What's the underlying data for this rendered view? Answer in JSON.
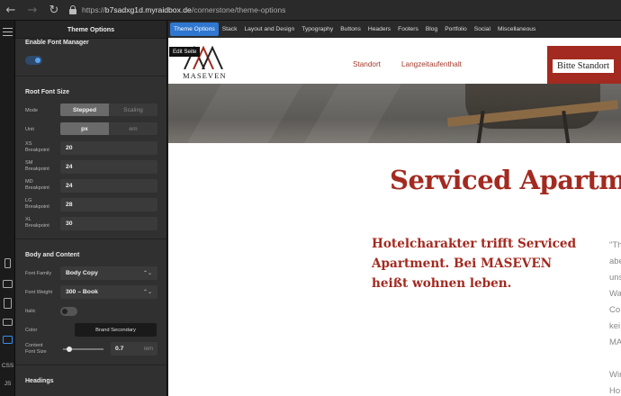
{
  "browser": {
    "url_scheme": "https://",
    "url_host": "b7sadxg1d.myraidbox.de",
    "url_path": "/cornerstone/theme-options"
  },
  "rail": {
    "css_label": "CSS",
    "js_label": "JS"
  },
  "panel": {
    "title": "Theme Options",
    "enable_font_manager": {
      "label": "Enable Font Manager",
      "enabled": true
    },
    "root_font_size": {
      "title": "Root Font Size",
      "mode": {
        "label": "Mode",
        "options": [
          "Stepped",
          "Scaling"
        ],
        "selected": "Stepped"
      },
      "unit": {
        "label": "Unit",
        "options": [
          "px",
          "em"
        ],
        "selected": "px"
      },
      "breakpoints": [
        {
          "label": "XS Breakpoint",
          "line1": "XS",
          "line2": "Breakpoint",
          "value": "20"
        },
        {
          "label": "SM Breakpoint",
          "line1": "SM",
          "line2": "Breakpoint",
          "value": "24"
        },
        {
          "label": "MD Breakpoint",
          "line1": "MD",
          "line2": "Breakpoint",
          "value": "24"
        },
        {
          "label": "LG Breakpoint",
          "line1": "LG",
          "line2": "Breakpoint",
          "value": "28"
        },
        {
          "label": "XL Breakpoint",
          "line1": "XL",
          "line2": "Breakpoint",
          "value": "30"
        }
      ]
    },
    "body_and_content": {
      "title": "Body and Content",
      "font_family": {
        "label": "Font Family",
        "value": "Body Copy"
      },
      "font_weight": {
        "label": "Font Weight",
        "value": "300 – Book"
      },
      "italic": {
        "label": "Italic",
        "enabled": false
      },
      "color": {
        "label": "Color",
        "value": "Brand Secondary"
      },
      "content_font_size": {
        "label_line1": "Content",
        "label_line2": "Font Size",
        "value": "0.7",
        "unit": "rem",
        "slider_fraction": 0.15
      }
    },
    "headings": {
      "title": "Headings"
    }
  },
  "tabs": [
    "Theme Options",
    "Stack",
    "Layout and Design",
    "Typography",
    "Buttons",
    "Headers",
    "Footers",
    "Blog",
    "Portfolio",
    "Social",
    "Miscellaneous"
  ],
  "selected_tab": "Theme Options",
  "preview": {
    "edit_label": "Edit Seite",
    "logo_text": "MASEVEN",
    "nav": [
      "Standort",
      "Langzeitaufenthalt"
    ],
    "cta": "Bitte Standort",
    "headline": "Serviced Apartm",
    "subheadline": "Hotelcharakter trifft Serviced Apartment. Bei MASEVEN heißt wohnen leben.",
    "side_text": [
      "\"Th",
      "abe",
      "uns",
      "Wa",
      "Co",
      "kei",
      "MA",
      "",
      "Wir",
      "Ho",
      "uns"
    ]
  },
  "colors": {
    "brand_red": "#a32a20",
    "accent_blue": "#2f77d0",
    "panel_bg": "#303030"
  }
}
